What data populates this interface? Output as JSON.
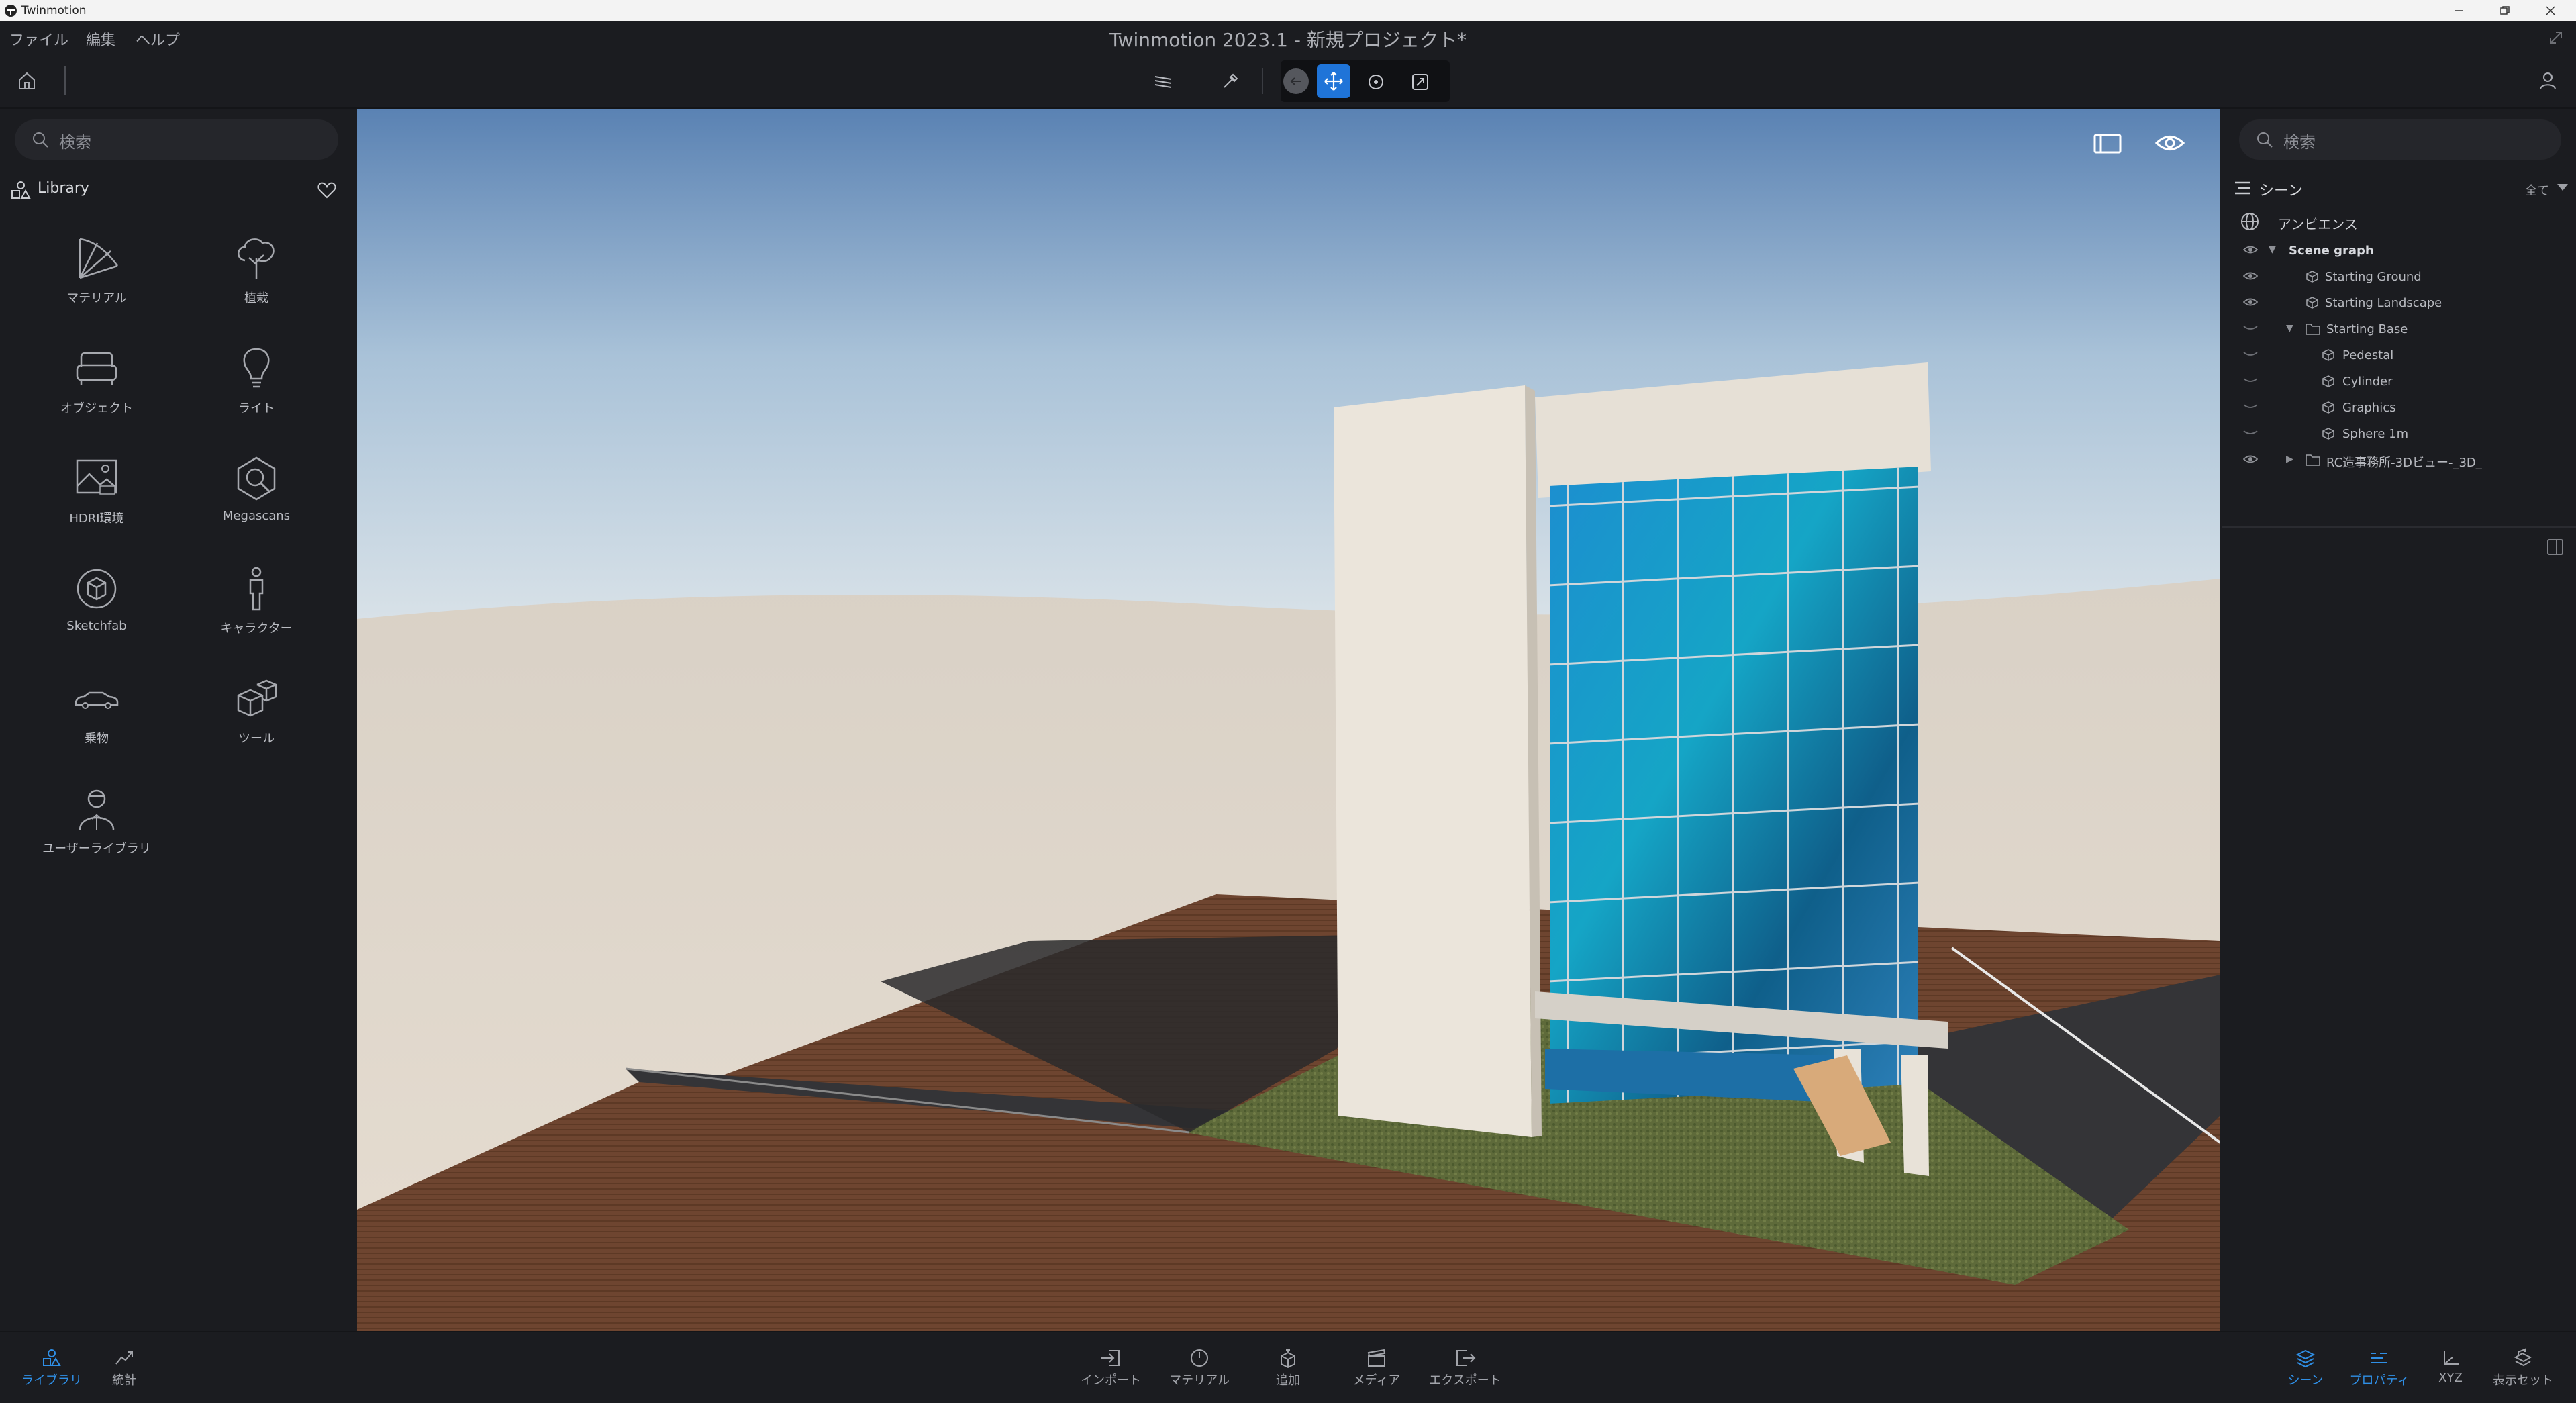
{
  "os_window": {
    "app_title": "Twinmotion"
  },
  "menu": {
    "items": [
      "ファイル",
      "編集",
      "ヘルプ"
    ]
  },
  "window_title": "Twinmotion 2023.1 - 新規プロジェクト*",
  "left_panel": {
    "search_placeholder": "検索",
    "library_label": "Library",
    "items": [
      {
        "label": "マテリアル",
        "icon": "material-fan-icon"
      },
      {
        "label": "植栽",
        "icon": "tree-icon"
      },
      {
        "label": "オブジェクト",
        "icon": "sofa-icon"
      },
      {
        "label": "ライト",
        "icon": "lightbulb-icon"
      },
      {
        "label": "HDRI環境",
        "icon": "hdri-image-icon"
      },
      {
        "label": "Megascans",
        "icon": "megascans-icon"
      },
      {
        "label": "Sketchfab",
        "icon": "sketchfab-icon"
      },
      {
        "label": "キャラクター",
        "icon": "person-icon"
      },
      {
        "label": "乗物",
        "icon": "car-icon"
      },
      {
        "label": "ツール",
        "icon": "cubes-icon"
      },
      {
        "label": "ユーザーライブラリ",
        "icon": "user-library-icon"
      }
    ]
  },
  "right_panel": {
    "search_placeholder": "検索",
    "scene_label": "シーン",
    "filter_label": "全て",
    "ambience_label": "アンビエンス",
    "tree": [
      {
        "label": "Scene graph",
        "visible": true
      },
      {
        "label": "Starting Ground",
        "visible": true
      },
      {
        "label": "Starting Landscape",
        "visible": true
      },
      {
        "label": "Starting Base",
        "visible": false
      },
      {
        "label": "Pedestal",
        "visible": false
      },
      {
        "label": "Cylinder",
        "visible": false
      },
      {
        "label": "Graphics",
        "visible": false
      },
      {
        "label": "Sphere 1m",
        "visible": false
      },
      {
        "label": "RC造事務所-3Dビュー-_3D_",
        "visible": true
      }
    ]
  },
  "bottom_bar": {
    "left": [
      {
        "label": "ライブラリ",
        "active": true
      },
      {
        "label": "統計",
        "active": false
      }
    ],
    "center": [
      {
        "label": "インポート"
      },
      {
        "label": "マテリアル"
      },
      {
        "label": "追加"
      },
      {
        "label": "メディア"
      },
      {
        "label": "エクスポート"
      }
    ],
    "right": [
      {
        "label": "シーン",
        "active": true
      },
      {
        "label": "プロパティ",
        "active": true
      },
      {
        "label": "XYZ",
        "active": false
      },
      {
        "label": "表示セット",
        "active": false
      }
    ]
  },
  "colors": {
    "accent": "#1f74d8",
    "panel": "#1b1c20",
    "active_text": "#2f8fe6"
  }
}
